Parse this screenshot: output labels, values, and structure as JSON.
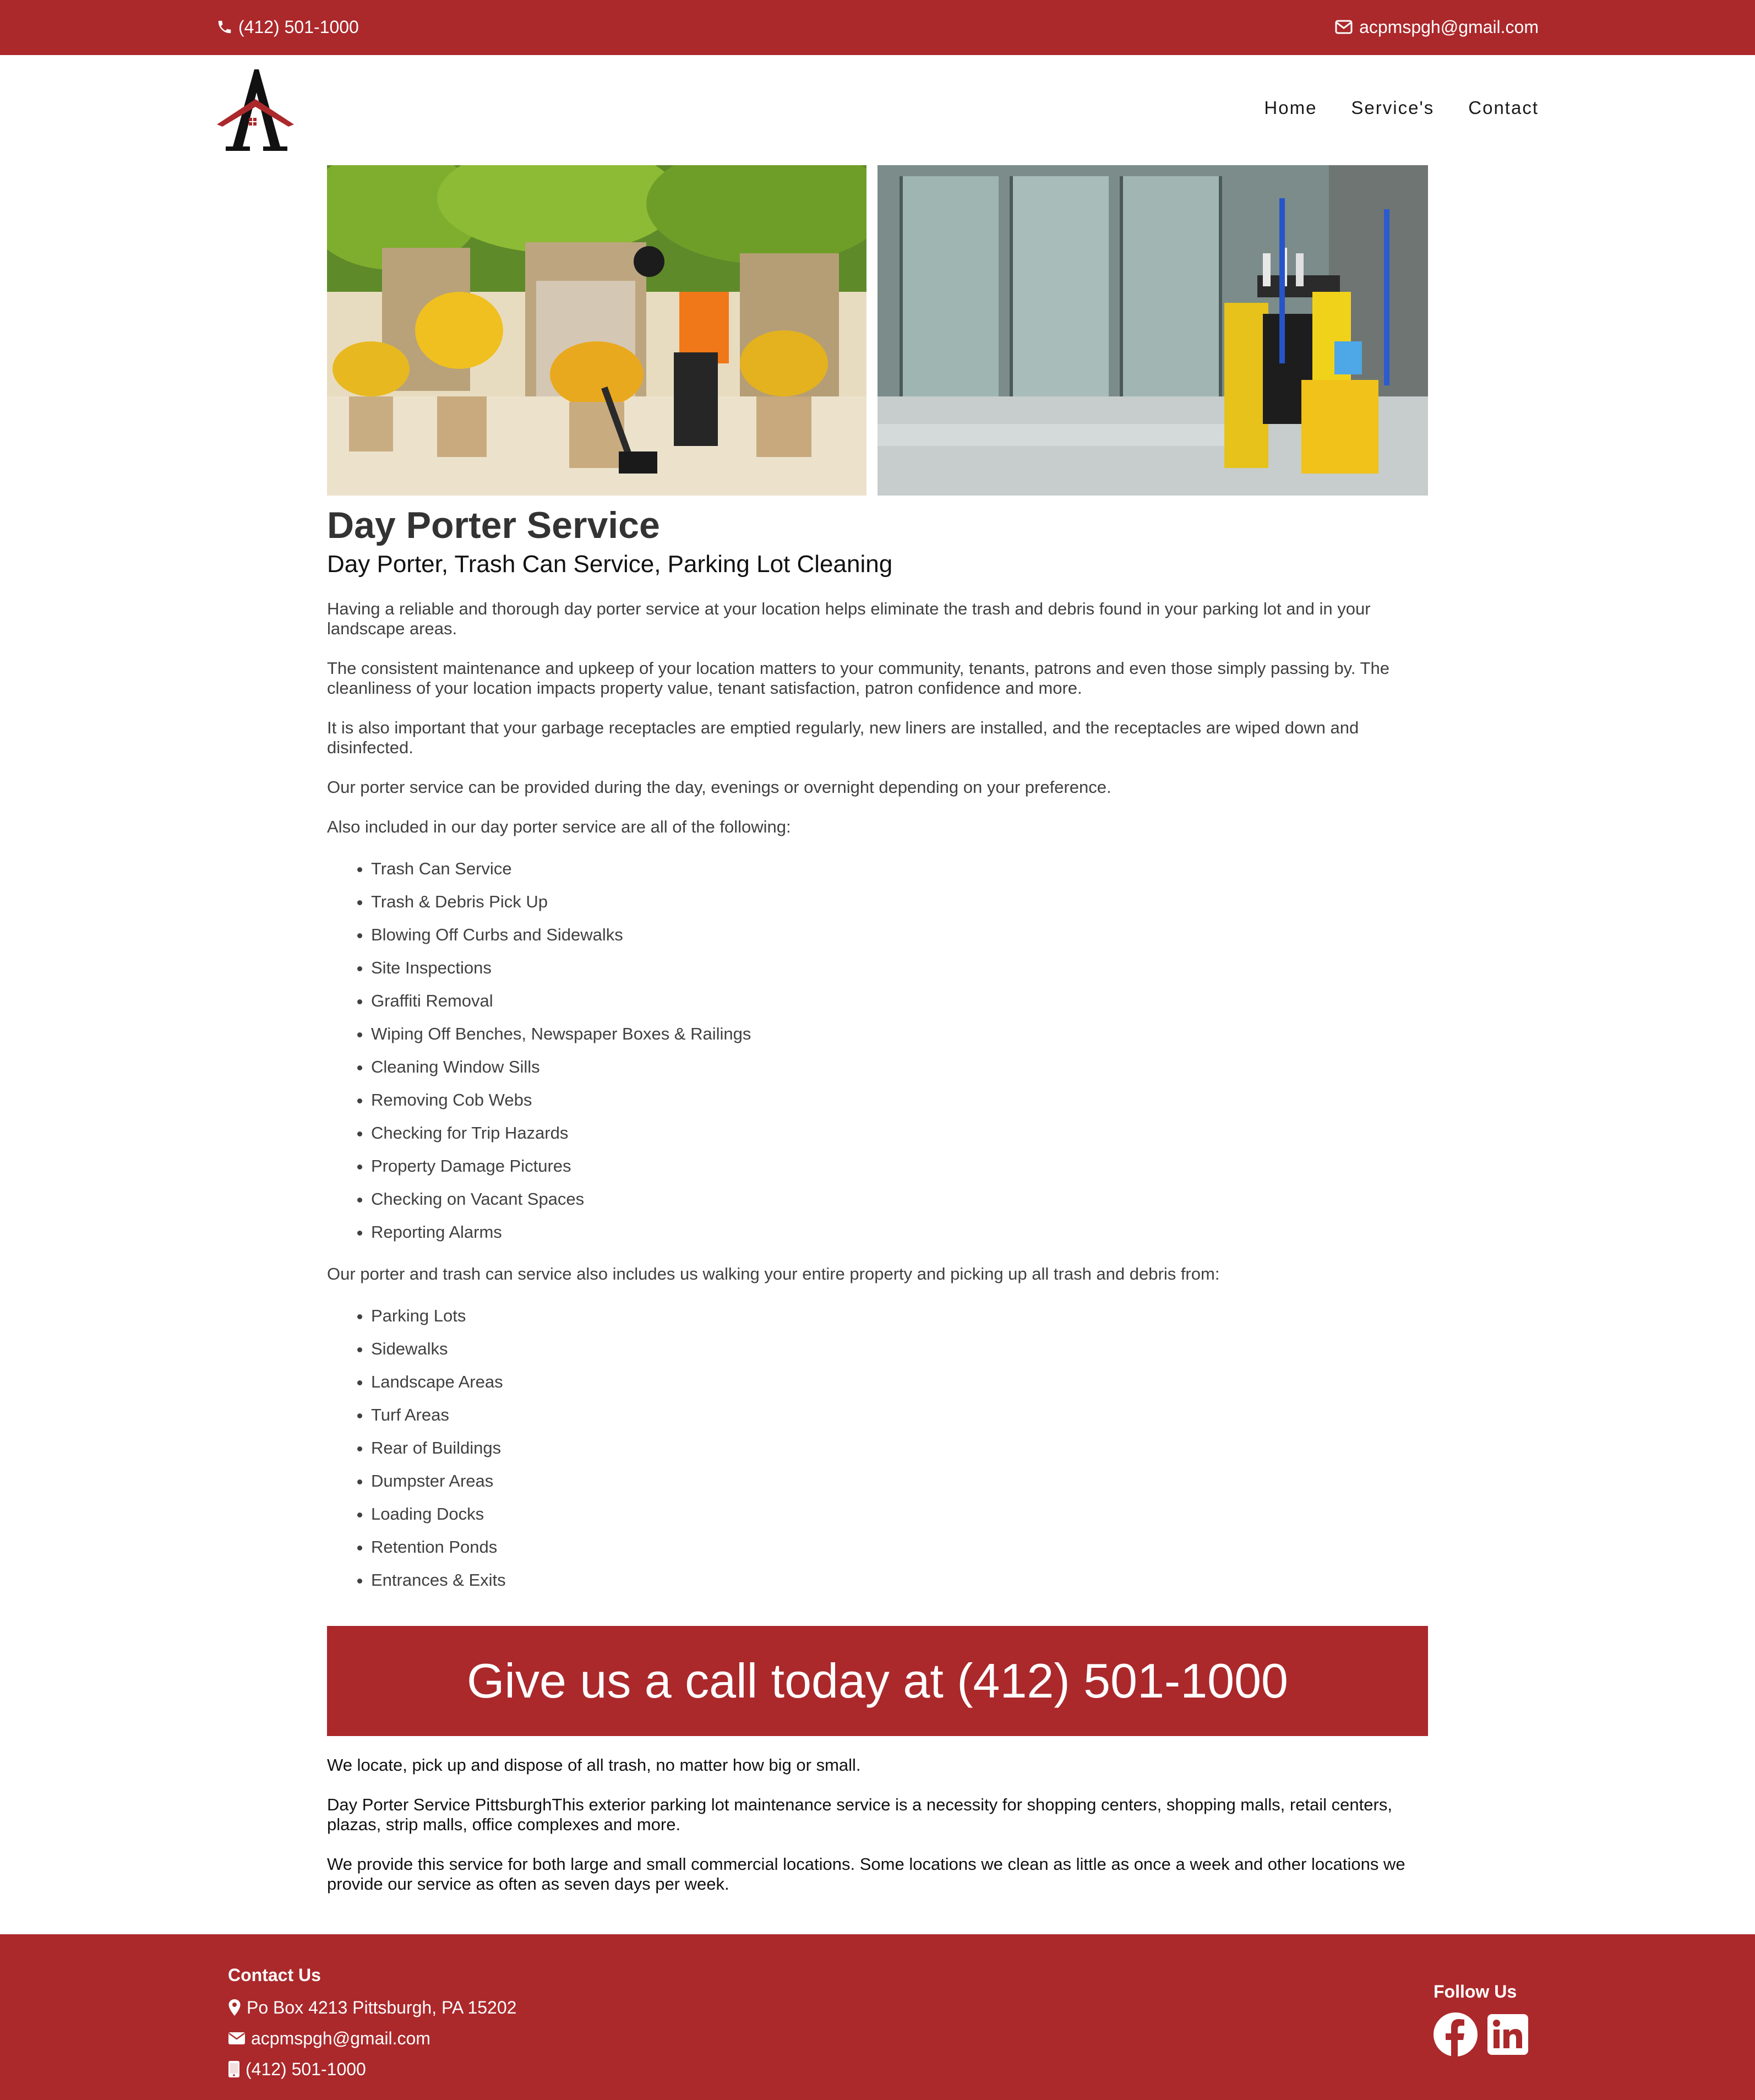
{
  "topbar": {
    "phone": "(412) 501-1000",
    "email": "acpmspgh@gmail.com",
    "phone_icon": "phone-icon",
    "email_icon": "envelope-icon"
  },
  "logo": {
    "letter": "A",
    "name": "house-logo"
  },
  "nav": {
    "home": "Home",
    "services": "Service's",
    "contact": "Contact"
  },
  "hero_images": [
    {
      "name": "porter-sweeping-fountain-photo"
    },
    {
      "name": "janitorial-cart-lobby-photo"
    }
  ],
  "main": {
    "title": "Day Porter Service",
    "subtitle": "Day Porter, Trash Can Service, Parking Lot Cleaning",
    "p1": "Having a reliable and thorough day porter service at your location helps eliminate the trash and debris found in your parking lot and in your landscape areas.",
    "p2": "The consistent maintenance and upkeep of your location matters to your community, tenants, patrons and even those simply passing by. The cleanliness of your location impacts property value, tenant satisfaction, patron confidence and more.",
    "p3": "It is also important that your garbage receptacles are emptied regularly, new liners are installed, and the receptacles are wiped down and disinfected.",
    "p4": "Our porter service can be provided during the day, evenings or overnight depending on your preference.",
    "p5": "Also included in our day porter service are all of the following:",
    "list1": [
      "Trash Can Service",
      "Trash & Debris Pick Up",
      "Blowing Off Curbs and Sidewalks",
      "Site Inspections",
      "Graffiti Removal",
      "Wiping Off Benches, Newspaper Boxes & Railings",
      "Cleaning Window Sills",
      "Removing Cob Webs",
      "Checking for Trip Hazards",
      "Property Damage Pictures",
      "Checking on Vacant Spaces",
      "Reporting Alarms"
    ],
    "p6": "Our porter and trash can service also includes us walking your entire property and picking up all trash and debris from:",
    "list2": [
      "Parking Lots",
      "Sidewalks",
      "Landscape Areas",
      "Turf Areas",
      "Rear of Buildings",
      "Dumpster Areas",
      "Loading Docks",
      "Retention Ponds",
      "Entrances & Exits"
    ]
  },
  "cta": {
    "text": "Give us a call today at (412) 501-1000"
  },
  "after": {
    "p1": "We locate, pick up and dispose of all trash, no matter how big or small.",
    "p2": "Day Porter Service PittsburghThis exterior parking lot maintenance service is a necessity for shopping centers, shopping malls, retail centers, plazas, strip malls, office complexes and more.",
    "p3": "We provide this service for both large and small commercial locations. Some locations we clean as little as once a week and other locations we provide our service as often as seven days per week."
  },
  "footer": {
    "contact_title": "Contact Us",
    "address": "Po Box 4213 Pittsburgh, PA 15202",
    "email": "acpmspgh@gmail.com",
    "phone": "(412) 501-1000",
    "follow_title": "Follow Us",
    "social": [
      "facebook-icon",
      "linkedin-icon"
    ]
  },
  "colors": {
    "brand_red": "#ab282b",
    "text": "#333333",
    "white": "#ffffff"
  }
}
